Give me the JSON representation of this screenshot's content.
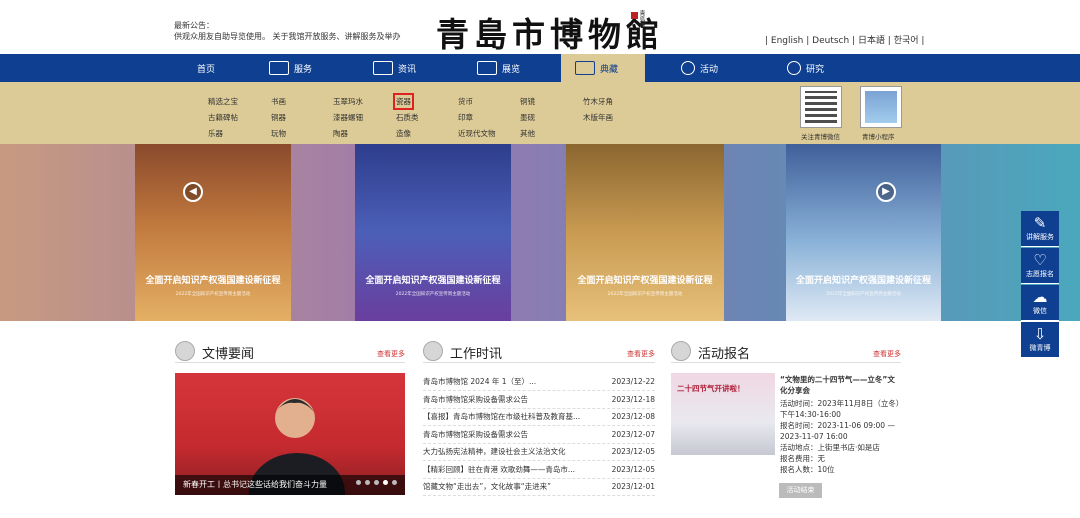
{
  "notice": {
    "label": "最新公告：",
    "text": "供观众朋友自助导览使用。 关于我馆开放服务、讲解服务及举办"
  },
  "logo": {
    "text": "青島市博物館",
    "seal": "青島市"
  },
  "languages": "| English | Deutsch | 日本語 | 한국어 |",
  "nav": [
    {
      "label": "首页",
      "icon": "home-icon"
    },
    {
      "label": "服务",
      "icon": "service-icon"
    },
    {
      "label": "资讯",
      "icon": "news-icon"
    },
    {
      "label": "展览",
      "icon": "exhibition-icon"
    },
    {
      "label": "典藏",
      "icon": "collection-icon"
    },
    {
      "label": "活动",
      "icon": "activity-icon"
    },
    {
      "label": "研究",
      "icon": "research-icon"
    }
  ],
  "submenu": {
    "col1": [
      "精选之宝",
      "古籍碑帖",
      "乐器"
    ],
    "col2": [
      "书画",
      "铜器",
      "玩物"
    ],
    "col3": [
      "玉翠玛水",
      "漆器螺钿",
      "陶器"
    ],
    "col4": [
      "瓷器",
      "石质类",
      "造像"
    ],
    "col5": [
      "货币",
      "印章",
      "近现代文物"
    ],
    "col6": [
      "铜镜",
      "墨砚",
      "其他"
    ],
    "col7": [
      "竹木牙角",
      "木版年画"
    ],
    "qr1": "关注青博微信",
    "qr2": "青博小程序"
  },
  "banner": {
    "caption": "全面开启知识产权强国建设新征程",
    "small": "2022年全国知识产权宣传周主题活动"
  },
  "side": [
    {
      "label": "讲解服务",
      "icon": "edit-icon"
    },
    {
      "label": "志愿报名",
      "icon": "heart-icon"
    },
    {
      "label": "微信",
      "icon": "wechat-icon"
    },
    {
      "label": "微青博",
      "icon": "download-icon"
    }
  ],
  "sections": {
    "news": {
      "title": "文博要闻",
      "more": "查看更多",
      "caption": "新春开工丨总书记这些话给我们奋斗力量"
    },
    "work": {
      "title": "工作时讯",
      "more": "查看更多",
      "items": [
        {
          "t": "青岛市博物馆 2024 年 1（至）...",
          "d": "2023/12-22"
        },
        {
          "t": "青岛市博物馆采购设备需求公告",
          "d": "2023/12-18"
        },
        {
          "t": "【喜报】青岛市博物馆在市级社科普及教育基...",
          "d": "2023/12-08"
        },
        {
          "t": "青岛市博物馆采购设备需求公告",
          "d": "2023/12-07"
        },
        {
          "t": "大力弘扬宪法精神，建设社会主义法治文化",
          "d": "2023/12-05"
        },
        {
          "t": "【精彩回顾】驻在青港 欢歌劲舞——青岛市...",
          "d": "2023/12-05"
        },
        {
          "t": "馆藏文物“走出去”，文化故事“走进来”",
          "d": "2023/12-01"
        }
      ]
    },
    "activity": {
      "title": "活动报名",
      "more": "查看更多",
      "img_text": "二十四节气开讲啦！",
      "name": "“文物里的二十四节气——立冬”文化分享会",
      "time": "活动时间：2023年11月8日（立冬）下午14:30-16:00",
      "signup": "报名时间：2023-11-06 09:00 — 2023-11-07 16:00",
      "place": "活动地点：上街里书店·如是店",
      "fee": "报名费用：无",
      "count": "报名人数：10位",
      "button": "活动结束"
    }
  }
}
